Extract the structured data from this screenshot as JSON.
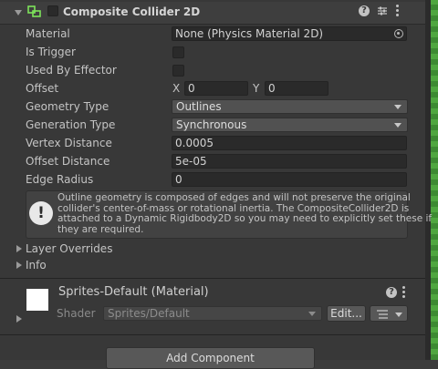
{
  "component": {
    "title": "Composite Collider 2D",
    "fields": {
      "material_label": "Material",
      "material_value": "None (Physics Material 2D)",
      "is_trigger_label": "Is Trigger",
      "used_by_effector_label": "Used By Effector",
      "offset_label": "Offset",
      "offset_x_label": "X",
      "offset_x_value": "0",
      "offset_y_label": "Y",
      "offset_y_value": "0",
      "geometry_type_label": "Geometry Type",
      "geometry_type_value": "Outlines",
      "generation_type_label": "Generation Type",
      "generation_type_value": "Synchronous",
      "vertex_distance_label": "Vertex Distance",
      "vertex_distance_value": "0.0005",
      "offset_distance_label": "Offset Distance",
      "offset_distance_value": "5e-05",
      "edge_radius_label": "Edge Radius",
      "edge_radius_value": "0"
    },
    "help": {
      "line1": "Outline geometry is composed of edges and will not preserve the original",
      "line2": "collider's center-of-mass or rotational inertia.  The CompositeCollider2D is",
      "line3": "attached to a Dynamic Rigidbody2D so you may need to explicitly set these if",
      "line4": "they are required."
    },
    "foldouts": {
      "layer_overrides": "Layer Overrides",
      "info": "Info"
    }
  },
  "material": {
    "title": "Sprites-Default (Material)",
    "shader_label": "Shader",
    "shader_value": "Sprites/Default",
    "edit_label": "Edit..."
  },
  "add_component_label": "Add Component",
  "colors": {
    "inspector_bg": "#383838",
    "field_bg": "#2a2a2a",
    "popup_bg": "#515151",
    "collider_icon": "#7ee35a"
  }
}
